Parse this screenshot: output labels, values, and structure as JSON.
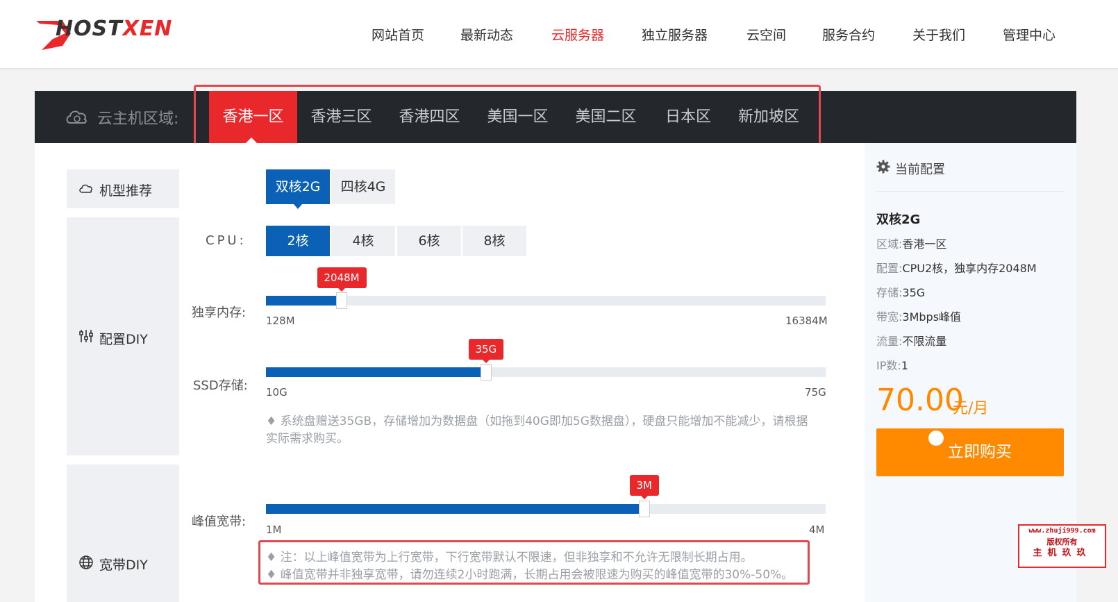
{
  "brand": {
    "logo_text_a": "HOST",
    "logo_text_b": "XEN"
  },
  "nav": {
    "items": [
      "网站首页",
      "最新动态",
      "云服务器",
      "独立服务器",
      "云空间",
      "服务合约",
      "关于我们",
      "管理中心"
    ],
    "active_index": 2
  },
  "region": {
    "label": "云主机区域:",
    "tabs": [
      "香港一区",
      "香港三区",
      "香港四区",
      "美国一区",
      "美国二区",
      "日本区",
      "新加坡区"
    ],
    "active_index": 0
  },
  "categories": {
    "recommend": "机型推荐",
    "config": "配置DIY",
    "bandwidth": "宽带DIY"
  },
  "presets": {
    "options": [
      "双核2G",
      "四核4G"
    ],
    "selected": 0
  },
  "cpu": {
    "label": "CPU:",
    "options": [
      "2核",
      "4核",
      "6核",
      "8核"
    ],
    "selected": 0
  },
  "memory": {
    "label": "独享内存:",
    "value_label": "2048M",
    "min": "128M",
    "max": "16384M",
    "fraction": 0.126
  },
  "ssd": {
    "label": "SSD存储:",
    "value_label": "35G",
    "min": "10G",
    "max": "75G",
    "fraction": 0.385,
    "note_line1": "♦ 系统盘赠送35GB，存储增加为数据盘（如拖到40G即加5G数据盘），硬盘只能增加不能减少，请根据",
    "note_line2": "实际需求购买。"
  },
  "bandwidth": {
    "label": "峰值宽带:",
    "value_label": "3M",
    "min": "1M",
    "max": "4M",
    "fraction": 0.667,
    "note_line1": "♦ 注：以上峰值宽带为上行宽带，下行宽带默认不限速，但非独享和不允许无限制长期占用。",
    "note_line2": "♦ 峰值宽带并非独享宽带，请勿连续2小时跑满，长期占用会被限速为购买的峰值宽带的30%-50%。"
  },
  "summary": {
    "heading": "当前配置",
    "plan": "双核2G",
    "rows": [
      {
        "k": "区域:",
        "v": "香港一区"
      },
      {
        "k": "配置:",
        "v": "CPU2核，独享内存2048M"
      },
      {
        "k": "存储:",
        "v": "35G"
      },
      {
        "k": "带宽:",
        "v": "3Mbps峰值"
      },
      {
        "k": "流量:",
        "v": "不限流量"
      },
      {
        "k": "IP数:",
        "v": "1"
      }
    ],
    "price": "70.00",
    "price_unit": "元/月",
    "buy_label": "立即购买"
  },
  "watermark": {
    "line1": "www.zhuji999.com",
    "line2": "版权所有",
    "line3": "主机玖玖"
  },
  "colors": {
    "accent_red": "#e8282b",
    "primary_blue": "#0a61b6",
    "orange": "#ff8a00",
    "dark_bar": "#24272b"
  }
}
